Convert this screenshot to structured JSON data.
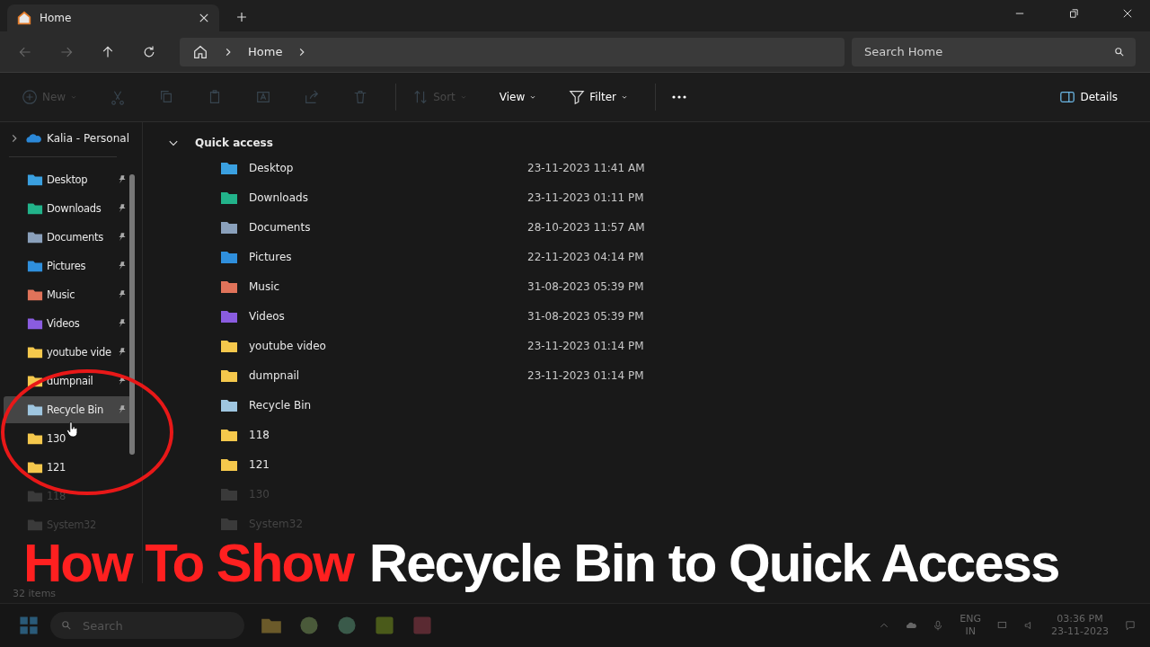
{
  "tab": {
    "title": "Home",
    "selected": true
  },
  "address": {
    "crumbs": [
      "Home"
    ]
  },
  "search": {
    "placeholder": "Search Home"
  },
  "toolbar": [
    {
      "kind": "new",
      "label": "New",
      "disabled": true
    },
    {
      "kind": "cut",
      "disabled": true
    },
    {
      "kind": "copy",
      "disabled": true
    },
    {
      "kind": "paste",
      "disabled": true
    },
    {
      "kind": "rename",
      "disabled": true
    },
    {
      "kind": "share",
      "disabled": true
    },
    {
      "kind": "delete",
      "disabled": true
    },
    {
      "kind": "sort",
      "label": "Sort",
      "disabled": true
    },
    {
      "kind": "view",
      "label": "View",
      "disabled": false
    },
    {
      "kind": "filter",
      "label": "Filter",
      "disabled": false
    },
    {
      "kind": "more",
      "disabled": false
    }
  ],
  "details_button": "Details",
  "sidebar": {
    "account": "Kalia - Personal",
    "items": [
      {
        "name": "Desktop",
        "kind": "desktop",
        "pinned": true,
        "selected": false,
        "faded": false
      },
      {
        "name": "Downloads",
        "kind": "downloads",
        "pinned": true,
        "selected": false,
        "faded": false
      },
      {
        "name": "Documents",
        "kind": "documents",
        "pinned": true,
        "selected": false,
        "faded": false
      },
      {
        "name": "Pictures",
        "kind": "pictures",
        "pinned": true,
        "selected": false,
        "faded": false
      },
      {
        "name": "Music",
        "kind": "music",
        "pinned": true,
        "selected": false,
        "faded": false
      },
      {
        "name": "Videos",
        "kind": "videos",
        "pinned": true,
        "selected": false,
        "faded": false
      },
      {
        "name": "youtube vide",
        "kind": "folder",
        "pinned": true,
        "selected": false,
        "faded": false
      },
      {
        "name": "dumpnail",
        "kind": "folder",
        "pinned": true,
        "selected": false,
        "faded": false
      },
      {
        "name": "Recycle Bin",
        "kind": "recycle",
        "pinned": true,
        "selected": true,
        "faded": false
      },
      {
        "name": "130",
        "kind": "folder",
        "pinned": false,
        "selected": false,
        "faded": false
      },
      {
        "name": "121",
        "kind": "folder",
        "pinned": false,
        "selected": false,
        "faded": false
      },
      {
        "name": "118",
        "kind": "folder",
        "pinned": false,
        "selected": false,
        "faded": true
      },
      {
        "name": "System32",
        "kind": "folder",
        "pinned": false,
        "selected": false,
        "faded": true
      }
    ]
  },
  "quick_access": {
    "title": "Quick access",
    "expanded": true,
    "rows": [
      {
        "name": "Desktop",
        "kind": "desktop",
        "date": "23-11-2023 11:41 AM",
        "faded": false
      },
      {
        "name": "Downloads",
        "kind": "downloads",
        "date": "23-11-2023 01:11 PM",
        "faded": false
      },
      {
        "name": "Documents",
        "kind": "documents",
        "date": "28-10-2023 11:57 AM",
        "faded": false
      },
      {
        "name": "Pictures",
        "kind": "pictures",
        "date": "22-11-2023 04:14 PM",
        "faded": false
      },
      {
        "name": "Music",
        "kind": "music",
        "date": "31-08-2023 05:39 PM",
        "faded": false
      },
      {
        "name": "Videos",
        "kind": "videos",
        "date": "31-08-2023 05:39 PM",
        "faded": false
      },
      {
        "name": "youtube video",
        "kind": "folder",
        "date": "23-11-2023 01:14 PM",
        "faded": false
      },
      {
        "name": "dumpnail",
        "kind": "folder",
        "date": "23-11-2023 01:14 PM",
        "faded": false
      },
      {
        "name": "Recycle Bin",
        "kind": "recycle",
        "faded": false
      },
      {
        "name": "118",
        "kind": "folder",
        "faded": false
      },
      {
        "name": "121",
        "kind": "folder",
        "faded": false
      },
      {
        "name": "130",
        "kind": "folder",
        "faded": true
      },
      {
        "name": "System32",
        "kind": "folder",
        "faded": true
      }
    ]
  },
  "status_bar": {
    "count": "32 items"
  },
  "taskbar": {
    "search_placeholder": "Search",
    "language": "ENG",
    "region": "IN",
    "time": "03:36 PM",
    "date": "23-11-2023"
  },
  "headline": [
    {
      "text": "How To Show",
      "color": "#ff2020"
    },
    {
      "text": "Recycle Bin to Quick Access",
      "color": "#ffffff"
    }
  ]
}
